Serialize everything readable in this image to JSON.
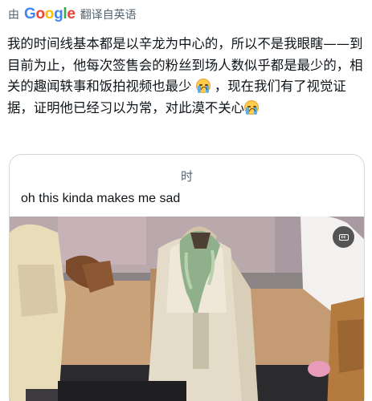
{
  "translate_bar": {
    "by_label": "由",
    "brand": [
      "G",
      "o",
      "o",
      "g",
      "l",
      "e"
    ],
    "action_label": "翻译自英语"
  },
  "post": {
    "text_part1": "我的时间线基本都是以辛龙为中心的，所以不是我眼瞎——到目前为止，他每次签售会的粉丝到场人数似乎都是最少的，相关的趣闻轶事和饭拍视频也最少",
    "text_part2": "，现在我们有了视觉证据，证明他已经习以为常，对此漠不关心"
  },
  "quote": {
    "header": "时",
    "text": "oh this kinda makes me sad"
  },
  "media": {
    "captions_label": "cc",
    "captions_icon": "closed-captions-icon"
  },
  "colors": {
    "secondary_text": "#536471",
    "border": "#cfd9de",
    "google_blue": "#4285f4",
    "google_red": "#ea4335",
    "google_yellow": "#fbbc05",
    "google_green": "#34a853"
  }
}
